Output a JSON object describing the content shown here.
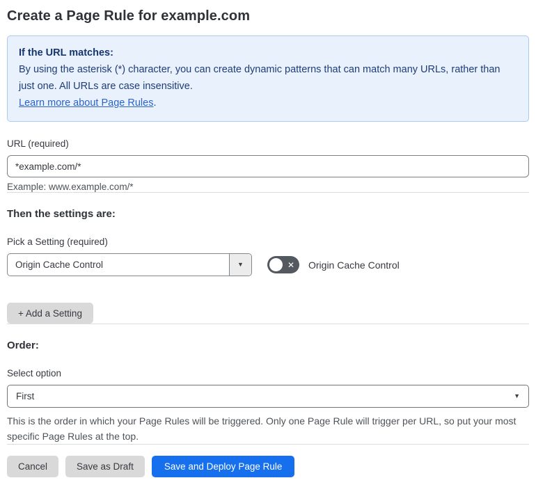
{
  "page": {
    "title": "Create a Page Rule for example.com"
  },
  "info_box": {
    "heading": "If the URL matches:",
    "body": "By using the asterisk (*) character, you can create dynamic patterns that can match many URLs, rather than just one. All URLs are case insensitive.",
    "link_label": "Learn more about Page Rules",
    "link_suffix": "."
  },
  "url_section": {
    "label": "URL (required)",
    "input_value": "*example.com/*",
    "helper": "Example: www.example.com/*"
  },
  "settings_section": {
    "heading": "Then the settings are:",
    "pick_label": "Pick a Setting (required)",
    "dropdown_value": "Origin Cache Control",
    "toggle_state": "off",
    "toggle_label": "Origin Cache Control",
    "add_button_label": "+ Add a Setting"
  },
  "order_section": {
    "heading": "Order:",
    "select_label": "Select option",
    "select_value": "First",
    "helper": "This is the order in which your Page Rules will be triggered. Only one Page Rule will trigger per URL, so put your most specific Page Rules at the top."
  },
  "footer": {
    "cancel_label": "Cancel",
    "save_draft_label": "Save as Draft",
    "save_deploy_label": "Save and Deploy Page Rule"
  },
  "icons": {
    "caret_down": "▼",
    "toggle_x": "✕"
  },
  "colors": {
    "primary_blue": "#1670ee",
    "info_bg": "#e9f2fc",
    "info_border": "#a9c9ee",
    "info_text": "#1e3c78",
    "link_blue": "#2c62c9",
    "toggle_off_bg": "#54595f",
    "gray_button_bg": "#d9d9d9"
  }
}
